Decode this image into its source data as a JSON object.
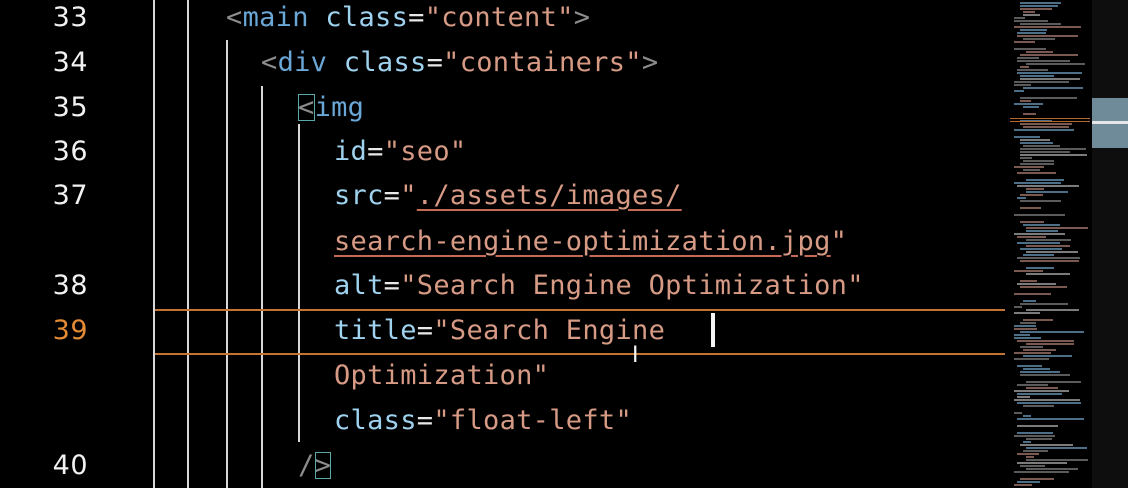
{
  "line_numbers": [
    "33",
    "34",
    "35",
    "36",
    "37",
    "38",
    "39",
    "40"
  ],
  "active_line": "39",
  "colors": {
    "background": "#000000",
    "active_line_number": "#e38a34",
    "active_line_border": "#c27430",
    "tag": "#6aa6d6",
    "attribute": "#9fd2ee",
    "string": "#d69a85",
    "punctuation": "#8c8c8c",
    "scrollbar_thumb": "#6f8b99"
  },
  "code": {
    "l33": {
      "open": "<",
      "tag": "main",
      "attr": "class",
      "eq": "=",
      "value": "\"content\"",
      "close": ">"
    },
    "l34": {
      "open": "<",
      "tag": "div",
      "attr": "class",
      "eq": "=",
      "value": "\"containers\"",
      "close": ">"
    },
    "l35": {
      "open": "<",
      "tag": "img"
    },
    "l36": {
      "attr": "id",
      "eq": "=",
      "value": "\"seo\""
    },
    "l37": {
      "attr": "src",
      "eq": "=",
      "quote": "\"",
      "path_part1": "./assets/images/"
    },
    "l37b": {
      "path_part2": "search-engine-optimization.jpg",
      "quote": "\""
    },
    "l38": {
      "attr": "alt",
      "eq": "=",
      "value": "\"Search Engine Optimization\""
    },
    "l39": {
      "attr": "title",
      "eq": "=",
      "value": "\"Search Engine "
    },
    "l39b": {
      "value": "Optimization\""
    },
    "l39c": {
      "attr": "class",
      "eq": "=",
      "value": "\"float-left\""
    },
    "l40": {
      "slash": "/",
      "close": ">"
    }
  },
  "cursor_glyph": "I",
  "minimap_icon": "code-minimap",
  "scrollbar_icon": "vertical-scrollbar"
}
